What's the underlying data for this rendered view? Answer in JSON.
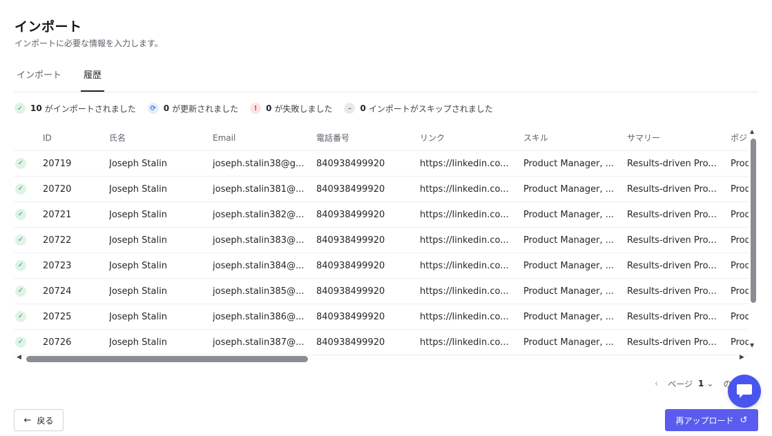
{
  "header": {
    "title": "インポート",
    "subtitle": "インポートに必要な情報を入力します。"
  },
  "tabs": [
    {
      "label": "インポート",
      "active": false
    },
    {
      "label": "履歴",
      "active": true
    }
  ],
  "stats": [
    {
      "count": "10",
      "label": "がインポートされました",
      "icon": "check-circle-icon"
    },
    {
      "count": "0",
      "label": "が更新されました",
      "icon": "refresh-icon"
    },
    {
      "count": "0",
      "label": "が失敗しました",
      "icon": "error-icon"
    },
    {
      "count": "0",
      "label": "インポートがスキップされました",
      "icon": "minus-circle-icon"
    }
  ],
  "table": {
    "columns": [
      "ID",
      "氏名",
      "Email",
      "電話番号",
      "リンク",
      "スキル",
      "サマリー",
      "ポジ"
    ],
    "rows": [
      {
        "id": "20719",
        "name": "Joseph Stalin",
        "email": "joseph.stalin38@g...",
        "phone": "840938499920",
        "link": "https://linkedin.co...",
        "skill": "Product Manager, ...",
        "summary": "Results-driven Pro...",
        "position": "Prod"
      },
      {
        "id": "20720",
        "name": "Joseph Stalin",
        "email": "joseph.stalin381@...",
        "phone": "840938499920",
        "link": "https://linkedin.co...",
        "skill": "Product Manager, ...",
        "summary": "Results-driven Pro...",
        "position": "Prod"
      },
      {
        "id": "20721",
        "name": "Joseph Stalin",
        "email": "joseph.stalin382@...",
        "phone": "840938499920",
        "link": "https://linkedin.co...",
        "skill": "Product Manager, ...",
        "summary": "Results-driven Pro...",
        "position": "Prod"
      },
      {
        "id": "20722",
        "name": "Joseph Stalin",
        "email": "joseph.stalin383@...",
        "phone": "840938499920",
        "link": "https://linkedin.co...",
        "skill": "Product Manager, ...",
        "summary": "Results-driven Pro...",
        "position": "Prod"
      },
      {
        "id": "20723",
        "name": "Joseph Stalin",
        "email": "joseph.stalin384@...",
        "phone": "840938499920",
        "link": "https://linkedin.co...",
        "skill": "Product Manager, ...",
        "summary": "Results-driven Pro...",
        "position": "Prod"
      },
      {
        "id": "20724",
        "name": "Joseph Stalin",
        "email": "joseph.stalin385@...",
        "phone": "840938499920",
        "link": "https://linkedin.co...",
        "skill": "Product Manager, ...",
        "summary": "Results-driven Pro...",
        "position": "Prod"
      },
      {
        "id": "20725",
        "name": "Joseph Stalin",
        "email": "joseph.stalin386@...",
        "phone": "840938499920",
        "link": "https://linkedin.co...",
        "skill": "Product Manager, ...",
        "summary": "Results-driven Pro...",
        "position": "Prod"
      },
      {
        "id": "20726",
        "name": "Joseph Stalin",
        "email": "joseph.stalin387@...",
        "phone": "840938499920",
        "link": "https://linkedin.co...",
        "skill": "Product Manager, ...",
        "summary": "Results-driven Pro...",
        "position": "Prod"
      }
    ]
  },
  "pagination": {
    "page_label": "ページ",
    "current_page": "1",
    "of_label": "の"
  },
  "footer": {
    "back_label": "戻る",
    "reupload_label": "再アップロード"
  },
  "colors": {
    "accent": "#5a5cf0",
    "chat_bubble": "#4a55f0",
    "success": "#2aa862",
    "updated": "#3b7be0",
    "failed": "#e0413d"
  }
}
